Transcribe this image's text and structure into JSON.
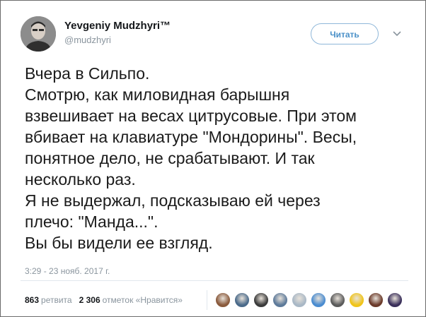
{
  "author": {
    "display_name": "Yevgeniy Mudzhyri™",
    "handle": "@mudzhyri"
  },
  "follow_button": {
    "label": "Читать"
  },
  "tweet": {
    "lines": [
      "Вчера в Сильпо.",
      "Смотрю, как миловидная барышня",
      "взвешивает на весах цитрусовые. При этом",
      "вбивает на клавиатуре \"Мондорины\". Весы,",
      "понятное дело, не срабатывают. И так",
      "несколько раз.",
      "Я не выдержал, подсказываю ей через",
      "плечо: \"Манда...\".",
      "Вы бы видели ее взгляд."
    ],
    "timestamp": "3:29 - 23 нояб. 2017 г."
  },
  "stats": {
    "retweets_count": "863",
    "retweets_label": "ретвита",
    "likes_count": "2 306",
    "likes_label": "отметок «Нравится»"
  },
  "likers": [
    {
      "icon": "avatar-1",
      "color": "#8a5a3c"
    },
    {
      "icon": "avatar-2",
      "color": "#4a6a8a"
    },
    {
      "icon": "avatar-3",
      "color": "#3b3b3b"
    },
    {
      "icon": "avatar-4",
      "color": "#5d7a9a"
    },
    {
      "icon": "avatar-5",
      "color": "#a9b8c6"
    },
    {
      "icon": "avatar-6",
      "color": "#4a8cd0"
    },
    {
      "icon": "avatar-7",
      "color": "#5b5b5b"
    },
    {
      "icon": "avatar-8",
      "color": "#f0c419"
    },
    {
      "icon": "avatar-9",
      "color": "#6b3a2a"
    },
    {
      "icon": "avatar-10",
      "color": "#3a2f5a"
    }
  ],
  "colors": {
    "follow_accent": "#4a90c8",
    "muted_text": "#8a959e"
  }
}
